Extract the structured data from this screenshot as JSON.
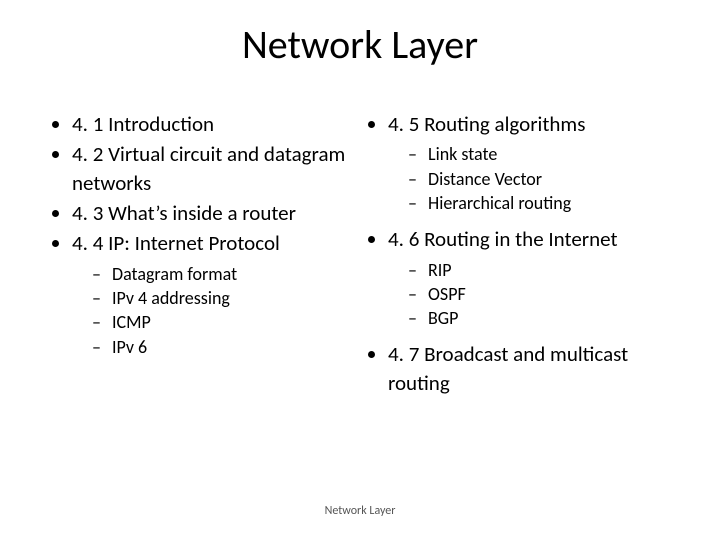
{
  "title": "Network Layer",
  "left": {
    "items": [
      "4. 1 Introduction",
      "4. 2 Virtual circuit and datagram networks",
      "4. 3 What’s inside a router",
      "4. 4 IP: Internet Protocol"
    ],
    "sub44": [
      "Datagram format",
      "IPv 4 addressing",
      "ICMP",
      "IPv 6"
    ]
  },
  "right": {
    "item45": "4. 5 Routing algorithms",
    "sub45": [
      "Link state",
      "Distance Vector",
      "Hierarchical routing"
    ],
    "item46": "4. 6 Routing in the Internet",
    "sub46": [
      "RIP",
      "OSPF",
      "BGP"
    ],
    "item47": "4. 7 Broadcast and multicast routing"
  },
  "footer": "Network Layer"
}
